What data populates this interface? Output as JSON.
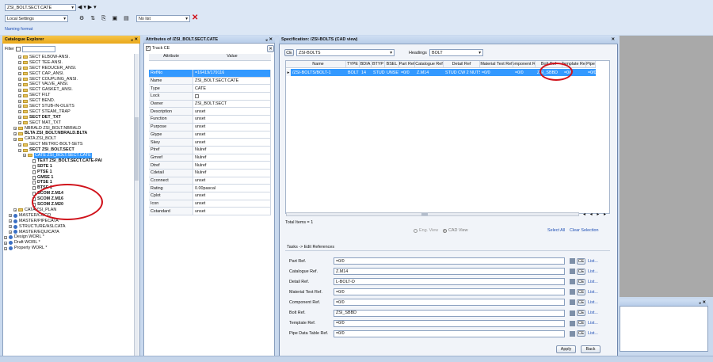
{
  "toolbar": {
    "element_combo": "ZSI_BOLT.SECT.CATE",
    "settings_combo": "Local Settings",
    "list_combo": "No list",
    "naming_format": "Naming format"
  },
  "catalogue": {
    "title": "Catalogue Explorer",
    "filter_label": "Filter",
    "items": [
      {
        "label": "SECT ELBOW-ANSI.",
        "icon": "folder",
        "indent": 3
      },
      {
        "label": "SECT TEE-ANSI.",
        "icon": "folder",
        "indent": 3
      },
      {
        "label": "SECT REDUCER_ANSI.",
        "icon": "folder",
        "indent": 3
      },
      {
        "label": "SECT CAP_ANSI.",
        "icon": "folder",
        "indent": 3
      },
      {
        "label": "SECT COUPLING_ANSI.",
        "icon": "folder",
        "indent": 3
      },
      {
        "label": "SECT VALVE_ANSI.",
        "icon": "folder",
        "indent": 3
      },
      {
        "label": "SECT GASKET_ANSI.",
        "icon": "folder",
        "indent": 3
      },
      {
        "label": "SECT FILT",
        "icon": "folder",
        "indent": 3
      },
      {
        "label": "SECT BEND.",
        "icon": "folder",
        "indent": 3
      },
      {
        "label": "SECT STUB-IN-OLETS",
        "icon": "folder",
        "indent": 3
      },
      {
        "label": "SECT STEAM_TRAP",
        "icon": "folder",
        "indent": 3
      },
      {
        "label": "SECT DET_TXT",
        "icon": "folder",
        "indent": 3,
        "bold": true
      },
      {
        "label": "SECT MAT_TXT",
        "icon": "folder",
        "indent": 3
      },
      {
        "label": "NBRALD ZSI_BOLT.NBRALD",
        "icon": "folder",
        "indent": 2
      },
      {
        "label": "BLTA ZSI_BOLT.NBRALD.BLTA",
        "icon": "folder",
        "indent": 2,
        "bold": true
      },
      {
        "label": "CATA ZSI_BOLT",
        "icon": "folder",
        "indent": 2
      },
      {
        "label": "SECT METRIC-BOLT-SETS",
        "icon": "folder",
        "indent": 3
      },
      {
        "label": "SECT ZSI_BOLT.SECT",
        "icon": "folder",
        "indent": 3,
        "bold": true
      },
      {
        "label": "CATE ZSI_BOLT.SECT.CATE",
        "icon": "folder",
        "indent": 4,
        "selected": true
      },
      {
        "label": "TEXT ZSI_BOLT.SECT.CATE-PAI",
        "icon": "doc",
        "indent": 5,
        "bold": true
      },
      {
        "label": "SDTE 1",
        "icon": "doc",
        "indent": 5,
        "bold": true
      },
      {
        "label": "PTSE 1",
        "icon": "doc",
        "indent": 5,
        "bold": true
      },
      {
        "label": "GMSE 1",
        "icon": "doc",
        "indent": 5,
        "bold": true
      },
      {
        "label": "DTSE 1",
        "icon": "doc",
        "indent": 5,
        "bold": true
      },
      {
        "label": "BTSE 1",
        "icon": "doc",
        "indent": 5,
        "bold": true
      },
      {
        "label": "SCOM Z.M14",
        "icon": "doc",
        "indent": 5,
        "bold": true
      },
      {
        "label": "SCOM Z.M16",
        "icon": "doc",
        "indent": 5,
        "bold": true
      },
      {
        "label": "SCOM Z.M20",
        "icon": "doc",
        "indent": 5,
        "bold": true
      },
      {
        "label": "CATA ZSI_PLAN",
        "icon": "folder",
        "indent": 2
      },
      {
        "label": "MASTER/COCO",
        "icon": "globe",
        "indent": 1
      },
      {
        "label": "MASTER/PIPECATA",
        "icon": "globe",
        "indent": 1
      },
      {
        "label": "STRUCTURE/ASLCATA",
        "icon": "globe",
        "indent": 1
      },
      {
        "label": "MASTER/EQUICATA",
        "icon": "globe",
        "indent": 1
      },
      {
        "label": "Design WORL *",
        "icon": "globe",
        "indent": 0
      },
      {
        "label": "Draft WORL *",
        "icon": "globe",
        "indent": 0
      },
      {
        "label": "Property WORL *",
        "icon": "globe",
        "indent": 0
      }
    ]
  },
  "attributes": {
    "title": "Attributes of /ZSI_BOLT.SECT.CATE",
    "track_label": "Track CE",
    "col_attribute": "Attribute",
    "col_value": "Value",
    "rows": [
      {
        "a": "RefNo",
        "v": "=16419/179116",
        "sel": true
      },
      {
        "a": "Name",
        "v": "ZSI_BOLT.SECT.CATE"
      },
      {
        "a": "Type",
        "v": "CATE"
      },
      {
        "a": "Lock",
        "v": ""
      },
      {
        "a": "Owner",
        "v": "ZSI_BOLT.SECT"
      },
      {
        "a": "Description",
        "v": "unset"
      },
      {
        "a": "Function",
        "v": "unset"
      },
      {
        "a": "Purpose",
        "v": "unset"
      },
      {
        "a": "Gtype",
        "v": "unset"
      },
      {
        "a": "Skey",
        "v": "unset"
      },
      {
        "a": "Ptref",
        "v": "Nulref"
      },
      {
        "a": "Gmref",
        "v": "Nulref"
      },
      {
        "a": "Dtref",
        "v": "Nulref"
      },
      {
        "a": "Cdetail",
        "v": "Nulref"
      },
      {
        "a": "Cconnect",
        "v": "unset"
      },
      {
        "a": "Rating",
        "v": "0.00pascal"
      },
      {
        "a": "Cplot",
        "v": "unset"
      },
      {
        "a": "Icon",
        "v": "unset"
      },
      {
        "a": "Cstandard",
        "v": "unset"
      }
    ]
  },
  "spec": {
    "title": "Specification: /ZSI-BOLTS (CAD view)",
    "ce_label": "CE",
    "spec_combo": "ZSI-BOLTS",
    "headings_label": "Headings",
    "headings_combo": "BOLT",
    "columns": [
      "Name",
      "TYPE",
      "BDIA",
      "BTYP",
      "BSEL",
      "Part Ref",
      "Catalogue Ref",
      "Detail Ref",
      "Material Text Ref",
      "Component Ref",
      "Bolt Ref",
      "Template Ref",
      "Pipe"
    ],
    "row": [
      "/ZSI-BOLTS/BOLT-1",
      "BOLT",
      "14",
      "STUD",
      "UNSET",
      "=0/0",
      "Z.M14",
      "STUD CW 2 NUTS",
      "=0/0",
      "=0/0",
      "ZSI_SBBD",
      "=0/0",
      "=0/0"
    ],
    "total_items": "Total Items = 1",
    "eng_view": "Eng. View",
    "cad_view": "CAD View",
    "select_all": "Select All",
    "clear_selection": "Clear Selection",
    "tasks_label": "Tasks -> Edit References",
    "refs": [
      {
        "label": "Part Ref.",
        "value": "=0/0"
      },
      {
        "label": "Catalogue Ref.",
        "value": "Z.M14"
      },
      {
        "label": "Detail Ref.",
        "value": "L-BOLT-D"
      },
      {
        "label": "Material Text Ref.",
        "value": "=0/0"
      },
      {
        "label": "Component Ref.",
        "value": "=0/0"
      },
      {
        "label": "Bolt Ref.",
        "value": "ZSI_SBBD"
      },
      {
        "label": "Template Ref.",
        "value": "=0/0"
      },
      {
        "label": "Pipe Data Table Ref.",
        "value": "=0/0"
      }
    ],
    "ce_btn": "CE",
    "list_link": "List...",
    "apply": "Apply",
    "back": "Back"
  },
  "colors": {
    "highlight": "#3399ff",
    "annotation": "#d0121b",
    "title_orange": "#f6c54a"
  }
}
